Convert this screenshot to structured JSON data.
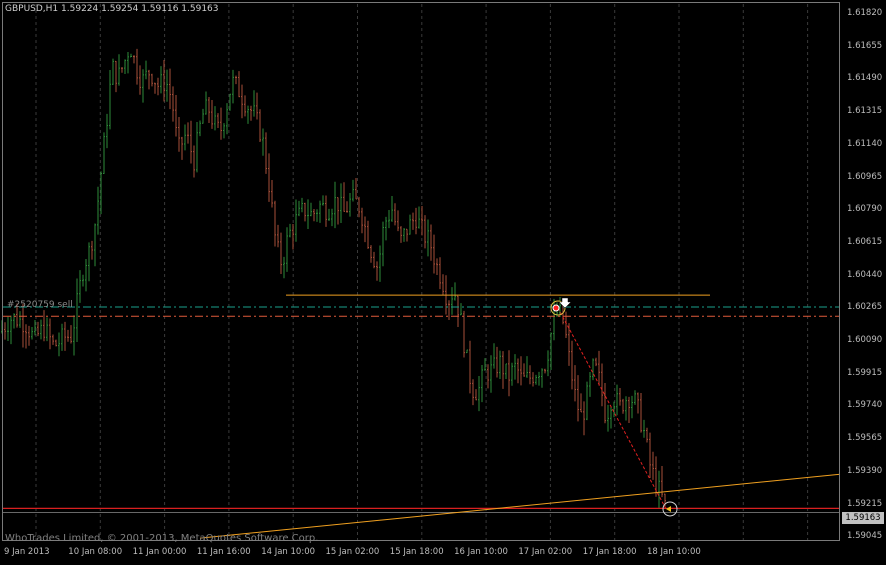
{
  "header": {
    "symbol": "GBPUSD,H1",
    "ohlc": "1.59224 1.59254 1.59116 1.59163"
  },
  "order_label": "#2520759 sell",
  "copyright": "WhoTrades Limited, © 2001-2013, MetaQuotes Software Corp.",
  "bid_label": "1.59163",
  "colors": {
    "background": "#000000",
    "bull_candle": "#2e8b3a",
    "bear_candle": "#a8503a",
    "grid": "#3a3a3a",
    "horizontal_line": "#f0a020",
    "trend_line": "#f0a020",
    "entry_line": "#1aa08c",
    "stoploss_line": "#e05a3a",
    "bid_line": "#d82020",
    "trade_path": "#e02020"
  },
  "price_axis": [
    "1.61820",
    "1.61655",
    "1.61490",
    "1.61315",
    "1.61140",
    "1.60965",
    "1.60790",
    "1.60615",
    "1.60440",
    "1.60265",
    "1.60090",
    "1.59915",
    "1.59740",
    "1.59565",
    "1.59390",
    "1.59215",
    "1.59045"
  ],
  "time_axis": [
    "9 Jan 2013",
    "10 Jan 08:00",
    "11 Jan 00:00",
    "11 Jan 16:00",
    "14 Jan 10:00",
    "15 Jan 02:00",
    "15 Jan 18:00",
    "16 Jan 10:00",
    "17 Jan 02:00",
    "17 Jan 18:00",
    "18 Jan 10:00"
  ],
  "chart_data": {
    "type": "candlestick",
    "symbol": "GBPUSD",
    "timeframe": "H1",
    "ylim": [
      1.5899,
      1.6188
    ],
    "close_path": [
      [
        0,
        1.6013
      ],
      [
        12,
        1.6021
      ],
      [
        25,
        1.6018
      ],
      [
        34,
        1.6009
      ],
      [
        44,
        1.6015
      ],
      [
        54,
        1.6005
      ],
      [
        64,
        1.601
      ],
      [
        72,
        1.6011
      ],
      [
        79,
        1.6035
      ],
      [
        84,
        1.605
      ],
      [
        90,
        1.6058
      ],
      [
        96,
        1.6075
      ],
      [
        102,
        1.6105
      ],
      [
        108,
        1.6135
      ],
      [
        112,
        1.6158
      ],
      [
        118,
        1.6152
      ],
      [
        124,
        1.616
      ],
      [
        130,
        1.617
      ],
      [
        136,
        1.6158
      ],
      [
        142,
        1.615
      ],
      [
        150,
        1.6156
      ],
      [
        158,
        1.6148
      ],
      [
        166,
        1.615
      ],
      [
        172,
        1.614
      ],
      [
        178,
        1.6112
      ],
      [
        186,
        1.6121
      ],
      [
        194,
        1.6107
      ],
      [
        202,
        1.6131
      ],
      [
        208,
        1.6136
      ],
      [
        214,
        1.6127
      ],
      [
        220,
        1.6122
      ],
      [
        226,
        1.6135
      ],
      [
        232,
        1.615
      ],
      [
        238,
        1.6146
      ],
      [
        246,
        1.6138
      ],
      [
        254,
        1.6132
      ],
      [
        262,
        1.612
      ],
      [
        270,
        1.609
      ],
      [
        276,
        1.606
      ],
      [
        282,
        1.605
      ],
      [
        288,
        1.6065
      ],
      [
        296,
        1.6074
      ],
      [
        304,
        1.608
      ],
      [
        312,
        1.6077
      ],
      [
        320,
        1.6082
      ],
      [
        328,
        1.608
      ],
      [
        336,
        1.6085
      ],
      [
        344,
        1.6078
      ],
      [
        352,
        1.6086
      ],
      [
        360,
        1.6081
      ],
      [
        366,
        1.6068
      ],
      [
        372,
        1.6056
      ],
      [
        378,
        1.6048
      ],
      [
        384,
        1.6072
      ],
      [
        392,
        1.608
      ],
      [
        400,
        1.6062
      ],
      [
        408,
        1.607
      ],
      [
        416,
        1.6076
      ],
      [
        424,
        1.6066
      ],
      [
        430,
        1.6062
      ],
      [
        436,
        1.605
      ],
      [
        442,
        1.6042
      ],
      [
        448,
        1.603
      ],
      [
        454,
        1.6036
      ],
      [
        460,
        1.6022
      ],
      [
        466,
        1.6
      ],
      [
        472,
        1.5982
      ],
      [
        478,
        1.598
      ],
      [
        484,
        1.599
      ],
      [
        492,
        1.5992
      ],
      [
        500,
        1.5996
      ],
      [
        508,
        1.5988
      ],
      [
        516,
        1.5994
      ],
      [
        522,
        1.5986
      ],
      [
        530,
        1.5988
      ],
      [
        538,
        1.5992
      ],
      [
        546,
        1.5996
      ],
      [
        552,
        1.6015
      ],
      [
        558,
        1.6025
      ],
      [
        564,
        1.6017
      ],
      [
        570,
        1.5995
      ],
      [
        576,
        1.5975
      ],
      [
        582,
        1.5965
      ],
      [
        588,
        1.598
      ],
      [
        594,
        1.5995
      ],
      [
        600,
        1.5985
      ],
      [
        606,
        1.5966
      ],
      [
        612,
        1.5978
      ],
      [
        620,
        1.5972
      ],
      [
        628,
        1.5978
      ],
      [
        636,
        1.5974
      ],
      [
        644,
        1.5958
      ],
      [
        650,
        1.594
      ],
      [
        656,
        1.593
      ],
      [
        662,
        1.5922
      ],
      [
        666,
        1.5916
      ]
    ],
    "horizontal_levels": [
      {
        "name": "support-level",
        "price": 1.6033
      },
      {
        "name": "order-entry-level",
        "price": 1.60265
      },
      {
        "name": "order-stop-level",
        "price": 1.60215
      },
      {
        "name": "bid-level",
        "price": 1.59163
      }
    ],
    "trend_line": {
      "from": [
        200,
        1.59
      ],
      "to": [
        840,
        1.5935
      ]
    },
    "trade": {
      "open_price": 1.6026,
      "close_price": 1.5916
    }
  }
}
